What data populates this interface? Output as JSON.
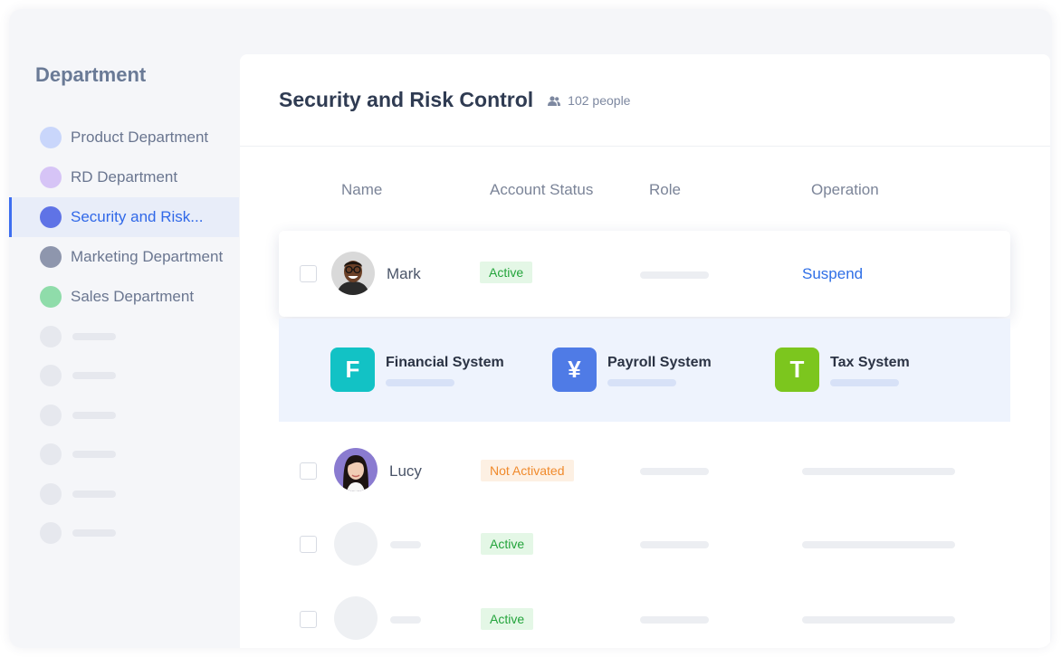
{
  "sidebar": {
    "title": "Department",
    "items": [
      {
        "label": "Product Department",
        "color": "#c9d6fb"
      },
      {
        "label": "RD Department",
        "color": "#d6c4f6"
      },
      {
        "label": "Security and Risk...",
        "color": "#5f73e6",
        "active": true
      },
      {
        "label": "Marketing Department",
        "color": "#8e96ad"
      },
      {
        "label": "Sales Department",
        "color": "#8fdcaa"
      }
    ]
  },
  "header": {
    "title": "Security and Risk Control",
    "people_count": "102 people"
  },
  "table": {
    "columns": [
      "Name",
      "Account Status",
      "Role",
      "Operation"
    ],
    "rows": [
      {
        "name": "Mark",
        "status": "Active",
        "operation": "Suspend"
      },
      {
        "name": "Lucy",
        "status": "Not Activated"
      },
      {
        "status": "Active"
      },
      {
        "status": "Active"
      }
    ]
  },
  "systems": [
    {
      "letter": "F",
      "name": "Financial System",
      "color": "#12c2c5"
    },
    {
      "letter": "¥",
      "name": "Payroll System",
      "color": "#4f7be6"
    },
    {
      "letter": "T",
      "name": "Tax System",
      "color": "#7cc61e"
    }
  ],
  "colors": {
    "accent": "#3068e8",
    "active_status": "#23a43b",
    "pending_status": "#f08a2c"
  }
}
